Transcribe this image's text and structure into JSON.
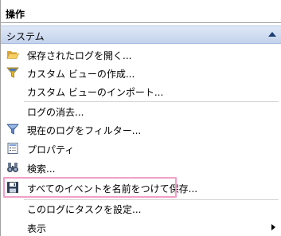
{
  "panel": {
    "title": "操作"
  },
  "section": {
    "title": "システム"
  },
  "items": [
    {
      "label": "保存されたログを開く...",
      "icon": "folder-open-icon"
    },
    {
      "label": "カスタム ビューの作成...",
      "icon": "filter-icon"
    },
    {
      "label": "カスタム ビューのインポート...",
      "icon": ""
    },
    {
      "label": "ログの消去...",
      "icon": ""
    },
    {
      "label": "現在のログをフィルター...",
      "icon": "filter-icon"
    },
    {
      "label": "プロパティ",
      "icon": "properties-icon"
    },
    {
      "label": "検索...",
      "icon": "binoculars-icon"
    },
    {
      "label": "すべてのイベントを名前をつけて保存...",
      "icon": "save-icon"
    },
    {
      "label": "このログにタスクを設定...",
      "icon": ""
    },
    {
      "label": "表示",
      "icon": ""
    }
  ]
}
